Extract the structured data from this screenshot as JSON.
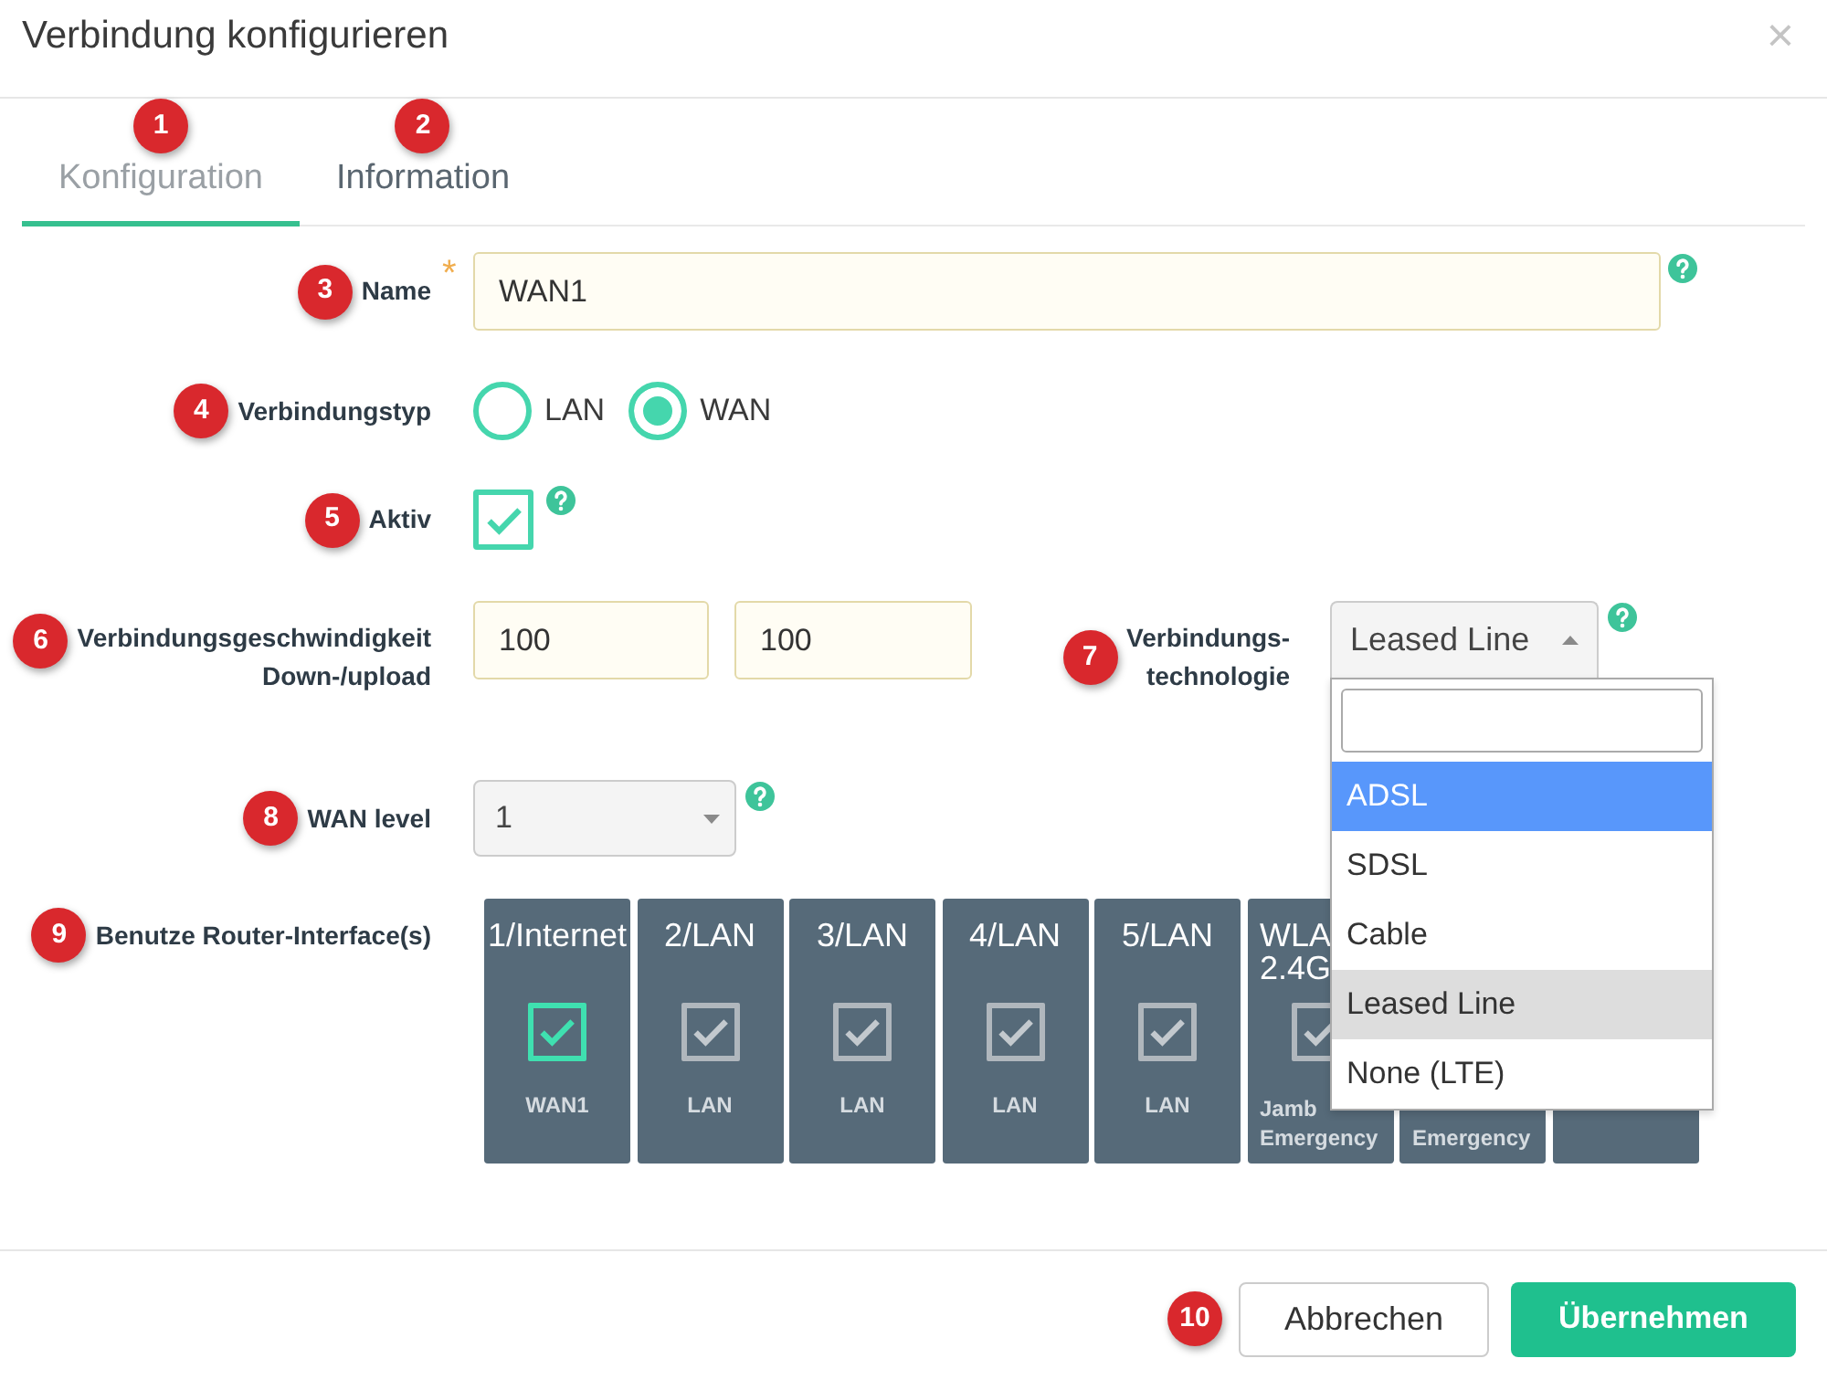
{
  "dialog": {
    "title": "Verbindung konfigurieren",
    "close": "×"
  },
  "tabs": [
    {
      "label": "Konfiguration",
      "selected": true,
      "marker": "1"
    },
    {
      "label": "Information",
      "selected": false,
      "marker": "2"
    }
  ],
  "form": {
    "name": {
      "marker": "3",
      "label": "Name",
      "required_mark": "*",
      "value": "WAN1",
      "help": true
    },
    "connection_type": {
      "marker": "4",
      "label": "Verbindungstyp",
      "options": [
        {
          "label": "LAN",
          "selected": false
        },
        {
          "label": "WAN",
          "selected": true
        }
      ]
    },
    "active": {
      "marker": "5",
      "label": "Aktiv",
      "checked": true,
      "help": true
    },
    "speed": {
      "marker": "6",
      "label": "Verbindungsgeschwindigkeit Down-/upload",
      "down": "100",
      "up": "100"
    },
    "technology": {
      "marker": "7",
      "label": "Verbindungs-technologie",
      "value": "Leased Line",
      "expanded": true,
      "help": true,
      "searchable": true,
      "options": [
        {
          "label": "ADSL",
          "selected": false,
          "highlighted": true
        },
        {
          "label": "SDSL",
          "selected": false,
          "highlighted": false
        },
        {
          "label": "Cable",
          "selected": false,
          "highlighted": false
        },
        {
          "label": "Leased Line",
          "selected": true,
          "highlighted": false
        },
        {
          "label": "None (LTE)",
          "selected": false,
          "highlighted": false
        }
      ]
    },
    "wan_level": {
      "marker": "8",
      "label": "WAN level",
      "value": "1",
      "expanded": false,
      "help": true
    },
    "interfaces": {
      "marker": "9",
      "label": "Benutze Router-Interface(s)",
      "items": [
        {
          "kind": "full",
          "title": "1/Internet",
          "checked": true,
          "disabled": false,
          "subtitle": "WAN1"
        },
        {
          "kind": "full",
          "title": "2/LAN",
          "checked": true,
          "disabled": true,
          "subtitle": "LAN"
        },
        {
          "kind": "full",
          "title": "3/LAN",
          "checked": true,
          "disabled": true,
          "subtitle": "LAN"
        },
        {
          "kind": "full",
          "title": "4/LAN",
          "checked": true,
          "disabled": true,
          "subtitle": "LAN"
        },
        {
          "kind": "full",
          "title": "5/LAN",
          "checked": true,
          "disabled": true,
          "subtitle": "LAN"
        },
        {
          "kind": "partial",
          "title": "WLA 2.4G",
          "checked": true,
          "disabled": true,
          "subtitle": "Jamb Emergency"
        },
        {
          "kind": "partial",
          "subtitle": "Emergency"
        },
        {
          "kind": "blank"
        }
      ]
    }
  },
  "footer": {
    "marker": "10",
    "buttons": [
      {
        "label": "Abbrechen",
        "kind": "secondary"
      },
      {
        "label": "Übernehmen",
        "kind": "primary"
      }
    ]
  }
}
